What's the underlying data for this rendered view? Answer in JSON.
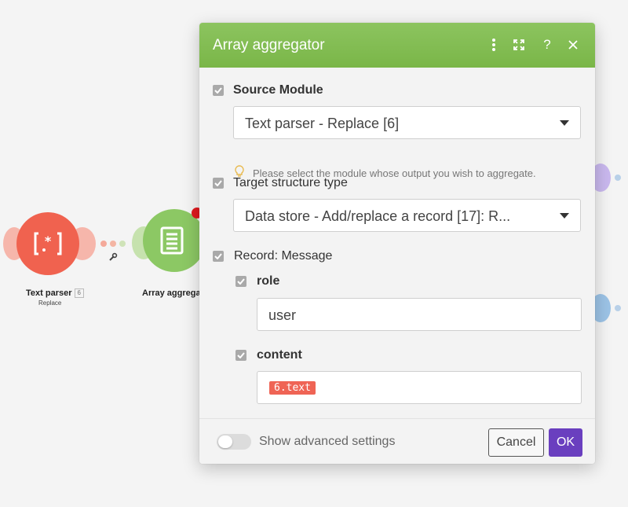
{
  "canvas": {
    "text_parser": {
      "label": "Text parser",
      "badge": "6",
      "sublabel": "Replace"
    },
    "array_aggregator": {
      "label": "Array aggrega"
    },
    "colors": {
      "text_parser": "#f0624f",
      "array_aggregator": "#8cc864",
      "link_dots": "#f4a99a"
    }
  },
  "dialog": {
    "title": "Array aggregator",
    "header_color": "#7ab648",
    "source_module": {
      "label": "Source Module",
      "value": "Text parser - Replace [6]",
      "hint": "Please select the module whose output you wish to aggregate."
    },
    "target_structure": {
      "label": "Target structure type",
      "value": "Data store - Add/replace a record [17]: R..."
    },
    "record": {
      "label": "Record: Message",
      "role": {
        "label": "role",
        "value": "user"
      },
      "content": {
        "label": "content",
        "pill": "6.text"
      }
    },
    "footer": {
      "advanced_label": "Show advanced settings",
      "cancel_label": "Cancel",
      "ok_label": "OK",
      "ok_color": "#6a3fbf"
    }
  }
}
